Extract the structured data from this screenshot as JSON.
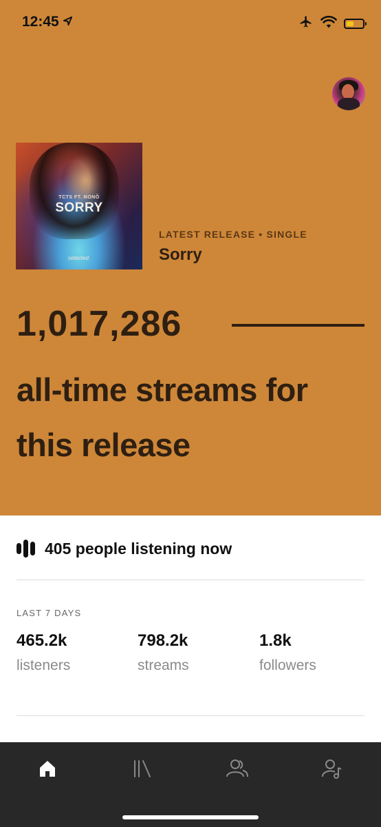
{
  "status_bar": {
    "time": "12:45",
    "icons": [
      "location-arrow-icon",
      "airplane-icon",
      "wifi-icon",
      "battery-icon"
    ],
    "battery_level": 0.45,
    "battery_color": "#f5c518"
  },
  "hero": {
    "background_color": "#ce8738",
    "cover": {
      "artist_line": "TCTS FT. NONÔ",
      "title": "SORRY",
      "label": "selected."
    },
    "release_meta": "LATEST RELEASE • SINGLE",
    "release_title": "Sorry",
    "stream_count": "1,017,286",
    "stream_caption": "all-time streams for this release"
  },
  "live": {
    "text": "405 people listening now"
  },
  "last7": {
    "label": "LAST 7 DAYS",
    "stats": [
      {
        "value": "465.2k",
        "label": "listeners"
      },
      {
        "value": "798.2k",
        "label": "streams"
      },
      {
        "value": "1.8k",
        "label": "followers"
      }
    ]
  },
  "tabbar": {
    "tabs": [
      {
        "icon": "home-icon",
        "active": true
      },
      {
        "icon": "library-icon",
        "active": false
      },
      {
        "icon": "audience-icon",
        "active": false
      },
      {
        "icon": "profile-music-icon",
        "active": false
      }
    ]
  }
}
